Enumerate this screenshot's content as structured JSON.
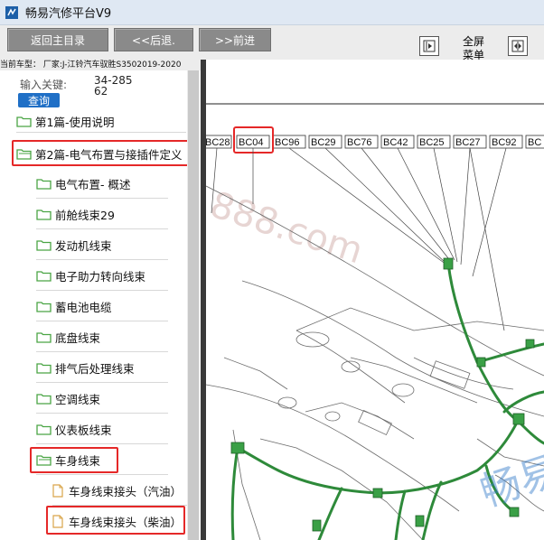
{
  "window": {
    "title": "畅易汽修平台V9"
  },
  "toolbar": {
    "home_label": "返回主目录",
    "back_label": "<<后退.",
    "forward_label": ">>前进",
    "fullscreen_line1": "全屏",
    "fullscreen_line2": "菜单"
  },
  "vehicle": {
    "text": "当前车型： 厂家:J-江铃汽车驭胜S3502019-2020"
  },
  "search": {
    "label": "输入关键:",
    "value": "34-28562",
    "button": "查询"
  },
  "tree": {
    "items": [
      {
        "label": "第1篇-使用说明"
      },
      {
        "label": "第2篇-电气布置与接插件定义"
      },
      {
        "label": "电气布置- 概述"
      },
      {
        "label": "前舱线束29"
      },
      {
        "label": "发动机线束"
      },
      {
        "label": "电子助力转向线束"
      },
      {
        "label": "蓄电池电缆"
      },
      {
        "label": "底盘线束"
      },
      {
        "label": "排气后处理线束"
      },
      {
        "label": "空调线束"
      },
      {
        "label": "仪表板线束"
      },
      {
        "label": "车身线束"
      },
      {
        "label": "车身线束接头（汽油）"
      },
      {
        "label": "车身线束接头（柴油）"
      }
    ]
  },
  "diagram": {
    "connectors": [
      "BC28",
      "BC04",
      "BC96",
      "BC29",
      "BC76",
      "BC42",
      "BC25",
      "BC27",
      "BC92",
      "BC"
    ],
    "watermark": "888.com",
    "watermark_cn": "畅易"
  },
  "colors": {
    "button_gray": "#8a8a8a",
    "query_blue": "#1f6fc6",
    "highlight_red": "#e52828",
    "harness_green": "#2e8a3a"
  }
}
